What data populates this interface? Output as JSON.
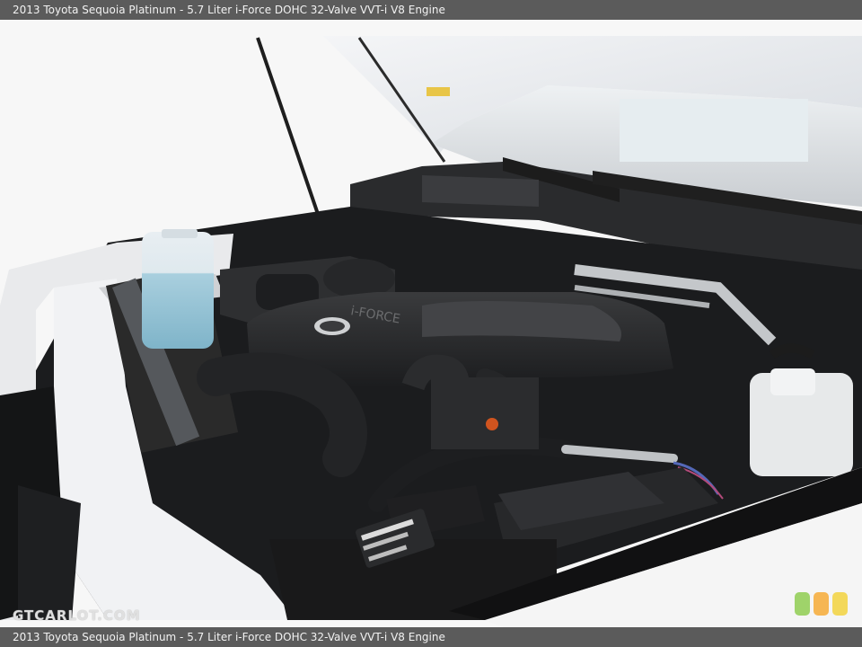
{
  "caption_top": "2013 Toyota Sequoia Platinum - 5.7 Liter i-Force DOHC 32-Valve VVT-i V8 Engine",
  "caption_bottom": "2013 Toyota Sequoia Platinum - 5.7 Liter i-Force DOHC 32-Valve VVT-i V8 Engine",
  "watermark": "GTCARLOT.COM",
  "colors": {
    "bar": "#5b5b5b",
    "dot_green": "#9fd36a",
    "dot_orange": "#f6b653",
    "dot_yellow": "#f3d85a"
  }
}
